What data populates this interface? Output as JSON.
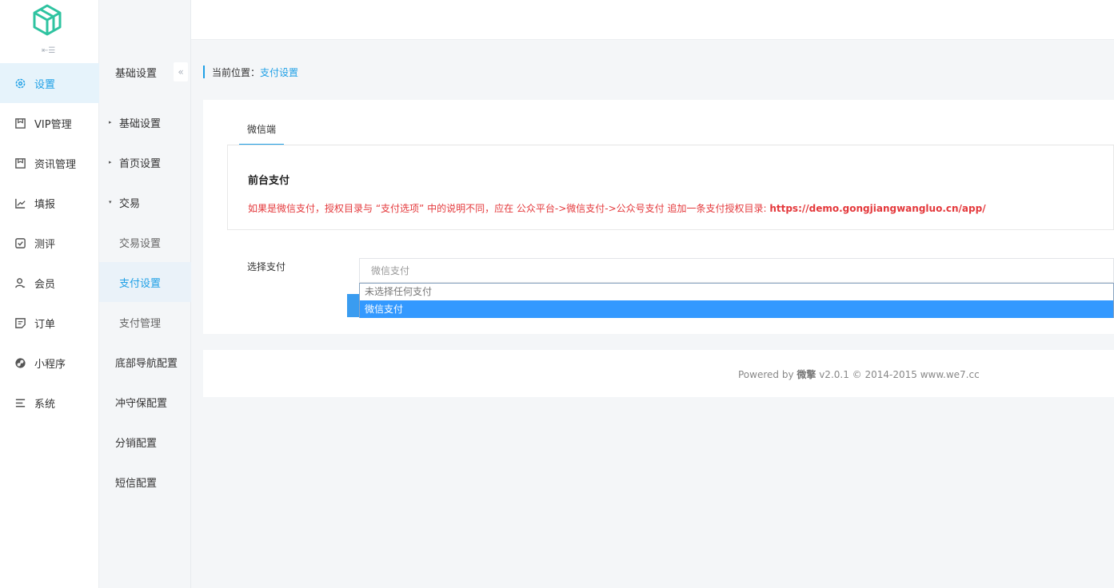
{
  "rail": {
    "toggle_symbol": "⇤☰",
    "items": [
      {
        "label": "设置",
        "icon": "gear-icon"
      },
      {
        "label": "VIP管理",
        "icon": "tag-icon"
      },
      {
        "label": "资讯管理",
        "icon": "tag-icon"
      },
      {
        "label": "填报",
        "icon": "chart-line-icon"
      },
      {
        "label": "测评",
        "icon": "check-square-icon"
      },
      {
        "label": "会员",
        "icon": "user-icon"
      },
      {
        "label": "订单",
        "icon": "document-icon"
      },
      {
        "label": "小程序",
        "icon": "link-circle-icon"
      },
      {
        "label": "系统",
        "icon": "list-icon"
      }
    ]
  },
  "sub": {
    "heading": "基础设置",
    "collapse_symbol": "«",
    "items": [
      {
        "label": "基础设置",
        "caret": "▸"
      },
      {
        "label": "首页设置",
        "caret": "▸"
      },
      {
        "label": "交易",
        "caret": "▾"
      },
      {
        "label": "交易设置"
      },
      {
        "label": "支付设置"
      },
      {
        "label": "支付管理"
      },
      {
        "label": "底部导航配置"
      },
      {
        "label": "冲守保配置"
      },
      {
        "label": "分销配置"
      },
      {
        "label": "短信配置"
      }
    ]
  },
  "breadcrumb": {
    "prefix": "当前位置：",
    "current": "支付设置"
  },
  "tab": {
    "label": "微信端"
  },
  "notice": {
    "title": "前台支付",
    "text": "如果是微信支付，授权目录与 “支付选项” 中的说明不同，应在 公众平台->微信支付->公众号支付 追加一条支付授权目录: ",
    "url": "https://demo.gongjiangwangluo.cn/app/"
  },
  "form": {
    "label": "选择支付",
    "selected": "微信支付",
    "options": [
      "未选择任何支付",
      "微信支付"
    ]
  },
  "footer": {
    "prefix": "Powered by ",
    "brand": "微擎",
    "suffix": " v2.0.1 © 2014-2015 www.we7.cc"
  },
  "colors": {
    "accent": "#1fa0e6",
    "warning": "#e4393c",
    "selection": "#3399ff",
    "logo": "#2ec3a0"
  }
}
